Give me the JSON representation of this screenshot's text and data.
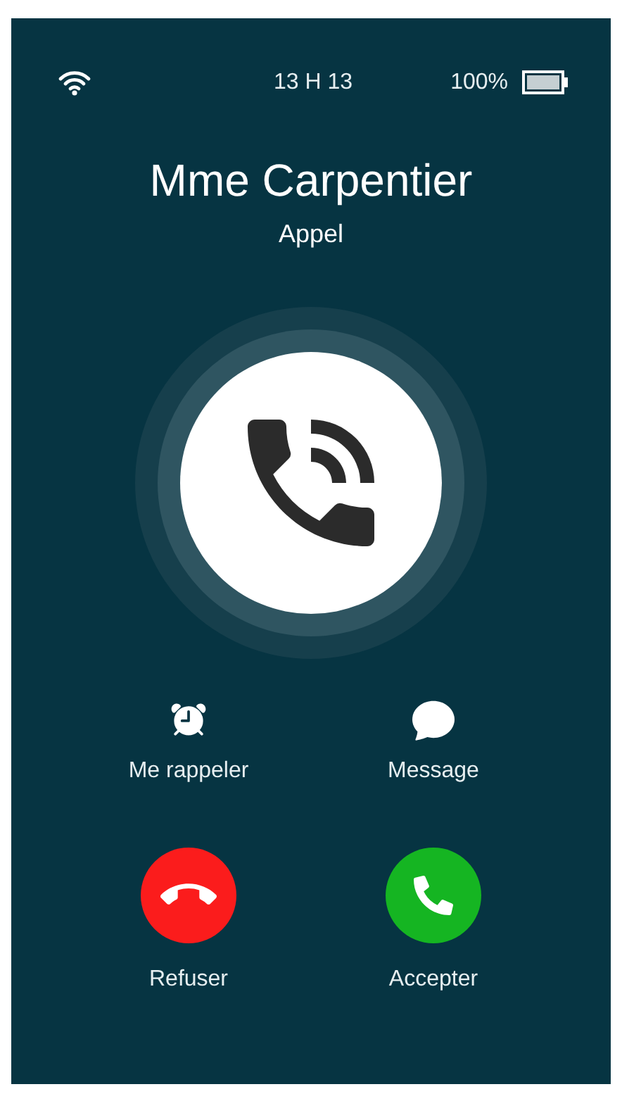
{
  "status_bar": {
    "time": "13 H 13",
    "battery": "100%"
  },
  "caller": {
    "name": "Mme Carpentier",
    "subtitle": "Appel"
  },
  "actions": [
    {
      "kind": "remind",
      "label": "Me rappeler"
    },
    {
      "kind": "message",
      "label": "Message"
    }
  ],
  "buttons": [
    {
      "kind": "decline",
      "label": "Refuser"
    },
    {
      "kind": "accept",
      "label": "Accepter"
    }
  ]
}
